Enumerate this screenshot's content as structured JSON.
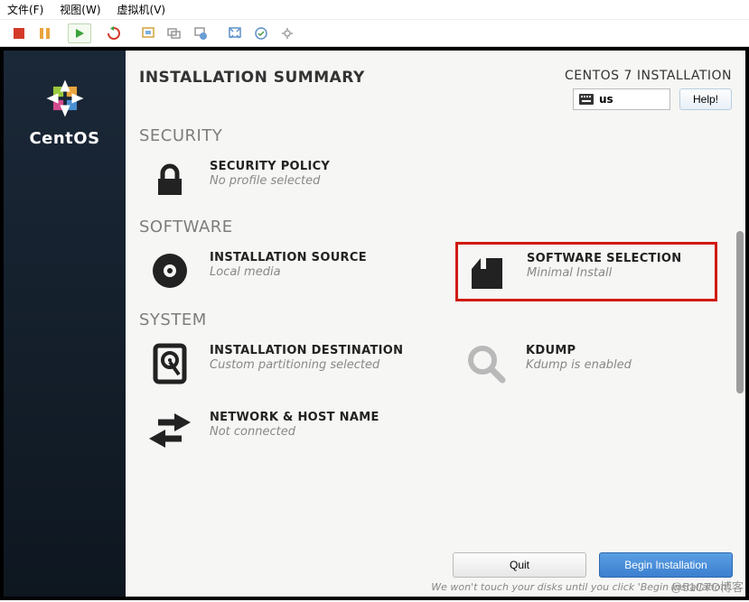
{
  "host": {
    "menu": {
      "file": "文件(F)",
      "view": "视图(W)",
      "vm": "虚拟机(V)"
    }
  },
  "header": {
    "title": "INSTALLATION SUMMARY",
    "product": "CENTOS 7 INSTALLATION",
    "lang": "us",
    "help": "Help!"
  },
  "brand": {
    "name": "CentOS"
  },
  "categories": {
    "security": {
      "label": "SECURITY"
    },
    "software": {
      "label": "SOFTWARE"
    },
    "system": {
      "label": "SYSTEM"
    }
  },
  "spokes": {
    "security_policy": {
      "title": "SECURITY POLICY",
      "status": "No profile selected"
    },
    "install_source": {
      "title": "INSTALLATION SOURCE",
      "status": "Local media"
    },
    "software_sel": {
      "title": "SOFTWARE SELECTION",
      "status": "Minimal Install"
    },
    "install_dest": {
      "title": "INSTALLATION DESTINATION",
      "status": "Custom partitioning selected"
    },
    "kdump": {
      "title": "KDUMP",
      "status": "Kdump is enabled"
    },
    "network": {
      "title": "NETWORK & HOST NAME",
      "status": "Not connected"
    }
  },
  "footer": {
    "quit": "Quit",
    "begin": "Begin Installation",
    "hint": "We won't touch your disks until you click 'Begin Installation'."
  },
  "watermark": "@51CTO博客"
}
